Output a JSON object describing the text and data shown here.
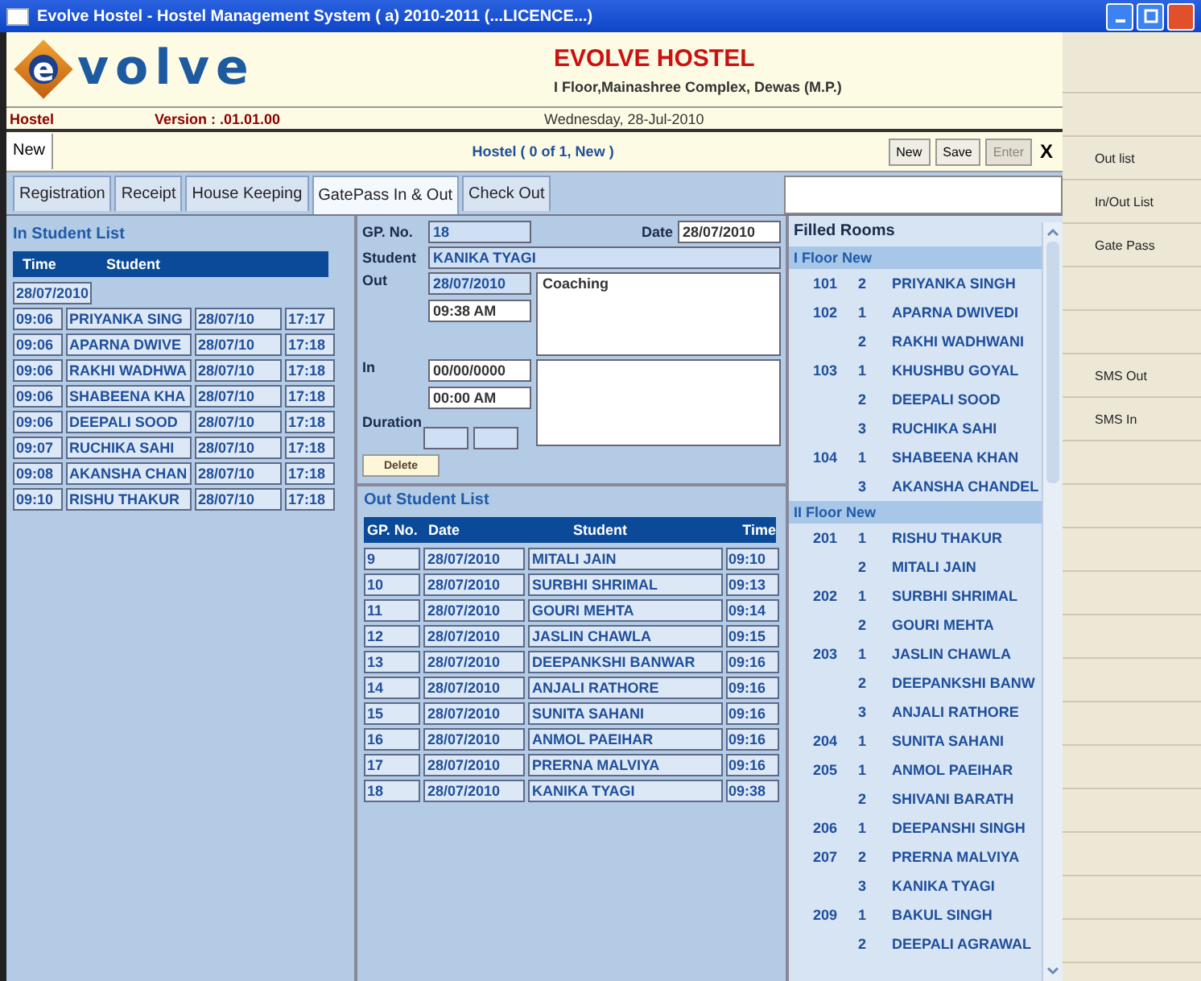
{
  "window": {
    "title": "Evolve Hostel - Hostel Management System ( a) 2010-2011 (...LICENCE...)"
  },
  "header": {
    "logo_mark": "e",
    "logo_text": "volve",
    "hostel_name": "EVOLVE HOSTEL",
    "address": "I Floor,Mainashree Complex, Dewas (M.P.)"
  },
  "info_bar": {
    "section": "Hostel",
    "version": "Version : .01.01.00",
    "date": "Wednesday, 28-Jul-2010"
  },
  "record_bar": {
    "mode": "New",
    "status": "Hostel  ( 0 of 1, New )",
    "buttons": [
      {
        "label": "New",
        "disabled": false
      },
      {
        "label": "Save",
        "disabled": false
      },
      {
        "label": "Enter",
        "disabled": true
      }
    ],
    "close": "X"
  },
  "tabs": [
    {
      "label": "Registration",
      "selected": false
    },
    {
      "label": "Receipt",
      "selected": false
    },
    {
      "label": "House Keeping",
      "selected": false
    },
    {
      "label": "GatePass In & Out",
      "selected": true
    },
    {
      "label": "Check Out",
      "selected": false
    }
  ],
  "in_list": {
    "title": "In Student List",
    "columns": [
      "Time",
      "Student"
    ],
    "date_group": "28/07/2010",
    "rows": [
      {
        "time": "09:06",
        "student": "PRIYANKA SING",
        "date": "28/07/10",
        "time_back": "17:17"
      },
      {
        "time": "09:06",
        "student": "APARNA  DWIVE",
        "date": "28/07/10",
        "time_back": "17:18"
      },
      {
        "time": "09:06",
        "student": "RAKHI WADHWA",
        "date": "28/07/10",
        "time_back": "17:18"
      },
      {
        "time": "09:06",
        "student": "SHABEENA KHA",
        "date": "28/07/10",
        "time_back": "17:18"
      },
      {
        "time": "09:06",
        "student": "DEEPALI  SOOD",
        "date": "28/07/10",
        "time_back": "17:18"
      },
      {
        "time": "09:07",
        "student": "RUCHIKA  SAHI",
        "date": "28/07/10",
        "time_back": "17:18"
      },
      {
        "time": "09:08",
        "student": "AKANSHA CHAN",
        "date": "28/07/10",
        "time_back": "17:18"
      },
      {
        "time": "09:10",
        "student": "RISHU  THAKUR",
        "date": "28/07/10",
        "time_back": "17:18"
      }
    ]
  },
  "gatepass": {
    "gp_label": "GP. No.",
    "gp_no": "18",
    "date_label": "Date",
    "date": "28/07/2010",
    "student_label": "Student",
    "student": "KANIKA  TYAGI",
    "out_label": "Out",
    "out_date": "28/07/2010",
    "out_time": "09:38 AM",
    "reason": "Coaching",
    "in_label": "In",
    "in_date": "00/00/0000",
    "in_time": "00:00 AM",
    "duration_label": "Duration",
    "delete_button": "Delete"
  },
  "out_list": {
    "title": "Out Student List",
    "columns": [
      "GP. No.",
      "Date",
      "Student",
      "Time"
    ],
    "rows": [
      {
        "gp_no": "9",
        "date": "28/07/2010",
        "student": "MITALI  JAIN",
        "time": "09:10"
      },
      {
        "gp_no": "10",
        "date": "28/07/2010",
        "student": "SURBHI  SHRIMAL",
        "time": "09:13"
      },
      {
        "gp_no": "11",
        "date": "28/07/2010",
        "student": "GOURI  MEHTA",
        "time": "09:14"
      },
      {
        "gp_no": "12",
        "date": "28/07/2010",
        "student": "JASLIN  CHAWLA",
        "time": "09:15"
      },
      {
        "gp_no": "13",
        "date": "28/07/2010",
        "student": "DEEPANKSHI  BANWAR",
        "time": "09:16"
      },
      {
        "gp_no": "14",
        "date": "28/07/2010",
        "student": "ANJALI  RATHORE",
        "time": "09:16"
      },
      {
        "gp_no": "15",
        "date": "28/07/2010",
        "student": "SUNITA  SAHANI",
        "time": "09:16"
      },
      {
        "gp_no": "16",
        "date": "28/07/2010",
        "student": "ANMOL  PAEIHAR",
        "time": "09:16"
      },
      {
        "gp_no": "17",
        "date": "28/07/2010",
        "student": "PRERNA  MALVIYA",
        "time": "09:16"
      },
      {
        "gp_no": "18",
        "date": "28/07/2010",
        "student": "KANIKA  TYAGI",
        "time": "09:38"
      }
    ]
  },
  "filled_rooms": {
    "title": "Filled Rooms",
    "floors": [
      {
        "name": "I Floor New",
        "rooms": [
          {
            "number": "101",
            "beds": [
              {
                "bed": "2",
                "student": "PRIYANKA SINGH"
              }
            ]
          },
          {
            "number": "102",
            "beds": [
              {
                "bed": "1",
                "student": "APARNA  DWIVEDI"
              },
              {
                "bed": "2",
                "student": "RAKHI WADHWANI"
              }
            ]
          },
          {
            "number": "103",
            "beds": [
              {
                "bed": "1",
                "student": "KHUSHBU  GOYAL"
              },
              {
                "bed": "2",
                "student": "DEEPALI  SOOD"
              },
              {
                "bed": "3",
                "student": "RUCHIKA  SAHI"
              }
            ]
          },
          {
            "number": "104",
            "beds": [
              {
                "bed": "1",
                "student": "SHABEENA KHAN"
              },
              {
                "bed": "3",
                "student": "AKANSHA CHANDEL"
              }
            ]
          }
        ]
      },
      {
        "name": "II Floor New",
        "rooms": [
          {
            "number": "201",
            "beds": [
              {
                "bed": "1",
                "student": "RISHU  THAKUR"
              },
              {
                "bed": "2",
                "student": "MITALI  JAIN"
              }
            ]
          },
          {
            "number": "202",
            "beds": [
              {
                "bed": "1",
                "student": "SURBHI  SHRIMAL"
              },
              {
                "bed": "2",
                "student": "GOURI  MEHTA"
              }
            ]
          },
          {
            "number": "203",
            "beds": [
              {
                "bed": "1",
                "student": "JASLIN  CHAWLA"
              },
              {
                "bed": "2",
                "student": "DEEPANKSHI  BANW"
              },
              {
                "bed": "3",
                "student": "ANJALI  RATHORE"
              }
            ]
          },
          {
            "number": "204",
            "beds": [
              {
                "bed": "1",
                "student": "SUNITA  SAHANI"
              }
            ]
          },
          {
            "number": "205",
            "beds": [
              {
                "bed": "1",
                "student": "ANMOL  PAEIHAR"
              },
              {
                "bed": "2",
                "student": "SHIVANI  BARATH"
              }
            ]
          },
          {
            "number": "206",
            "beds": [
              {
                "bed": "1",
                "student": "DEEPANSHI  SINGH"
              }
            ]
          },
          {
            "number": "207",
            "beds": [
              {
                "bed": "2",
                "student": "PRERNA  MALVIYA"
              },
              {
                "bed": "3",
                "student": "KANIKA  TYAGI"
              }
            ]
          },
          {
            "number": "209",
            "beds": [
              {
                "bed": "1",
                "student": "BAKUL  SINGH"
              },
              {
                "bed": "2",
                "student": "DEEPALI  AGRAWAL"
              }
            ]
          }
        ]
      }
    ]
  },
  "sidebar": {
    "items": [
      {
        "label": "Out list"
      },
      {
        "label": "In/Out List"
      },
      {
        "label": "Gate Pass"
      },
      {
        "label": "SMS Out"
      },
      {
        "label": "SMS In"
      }
    ]
  }
}
